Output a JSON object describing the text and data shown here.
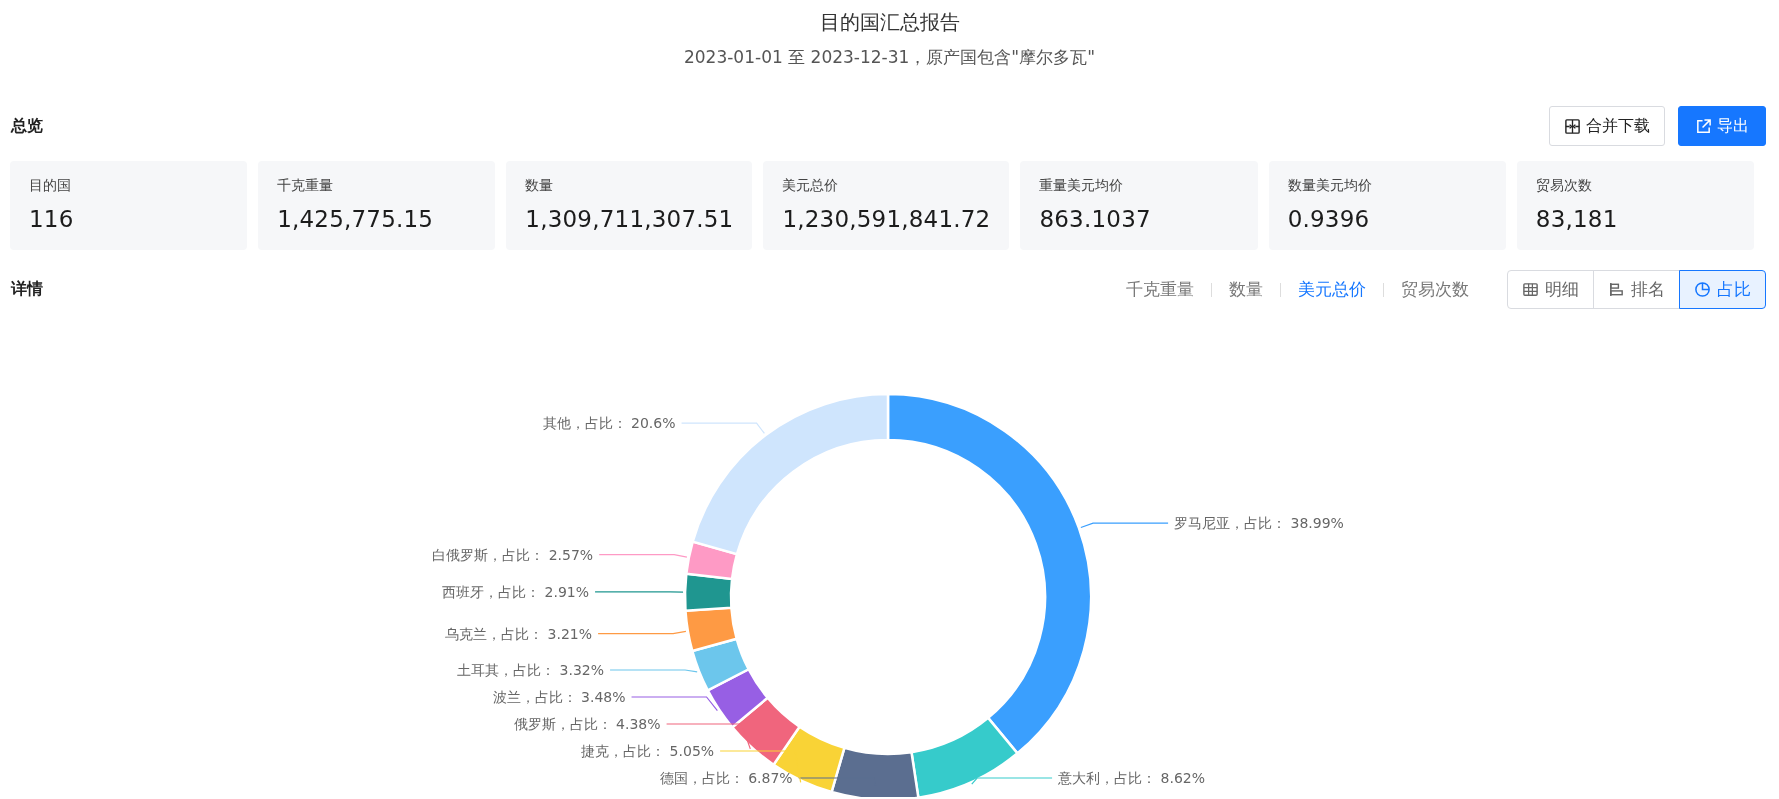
{
  "header": {
    "title": "目的国汇总报告",
    "subtitle": "2023-01-01 至 2023-12-31，原产国包含\"摩尔多瓦\""
  },
  "overview": {
    "title": "总览",
    "buttons": [
      {
        "label": "合并下载",
        "kind": "merge"
      },
      {
        "label": "导出",
        "kind": "export"
      }
    ],
    "cards": [
      {
        "label": "目的国",
        "value": "116"
      },
      {
        "label": "千克重量",
        "value": "1,425,775.15"
      },
      {
        "label": "数量",
        "value": "1,309,711,307.51"
      },
      {
        "label": "美元总价",
        "value": "1,230,591,841.72"
      },
      {
        "label": "重量美元均价",
        "value": "863.1037"
      },
      {
        "label": "数量美元均价",
        "value": "0.9396"
      },
      {
        "label": "贸易次数",
        "value": "83,181"
      }
    ]
  },
  "details": {
    "title": "详情",
    "metric_tabs": [
      {
        "label": "千克重量",
        "selected": false
      },
      {
        "label": "数量",
        "selected": false
      },
      {
        "label": "美元总价",
        "selected": true
      },
      {
        "label": "贸易次数",
        "selected": false
      }
    ],
    "view_buttons": [
      {
        "label": "明细",
        "kind": "table",
        "selected": false
      },
      {
        "label": "排名",
        "kind": "rank",
        "selected": false
      },
      {
        "label": "占比",
        "kind": "pie",
        "selected": true
      }
    ],
    "chart_data": {
      "type": "donut",
      "categories": [
        "罗马尼亚",
        "意大利",
        "德国",
        "捷克",
        "俄罗斯",
        "波兰",
        "土耳其",
        "乌克兰",
        "西班牙",
        "白俄罗斯",
        "其他"
      ],
      "values": [
        38.99,
        8.62,
        6.87,
        5.05,
        4.38,
        3.48,
        3.32,
        3.21,
        2.91,
        2.57,
        20.6
      ],
      "colors": [
        "#3a9ffe",
        "#36cbcb",
        "#5b6e90",
        "#f9d336",
        "#f0657d",
        "#975fe4",
        "#6cc6ec",
        "#fe9a44",
        "#1f9690",
        "#fe9ac5",
        "#cfe5fd"
      ],
      "value_labels": [
        "，占比： 38.99%",
        "，占比： 8.62%",
        "，占比： 6.87%",
        "，占比： 5.05%",
        "，占比： 4.38%",
        "，占比： 3.48%",
        "，占比： 3.32%",
        "，占比： 3.21%",
        "，占比： 2.91%",
        "，占比： 2.57%",
        "，占比： 20.6%"
      ]
    }
  }
}
